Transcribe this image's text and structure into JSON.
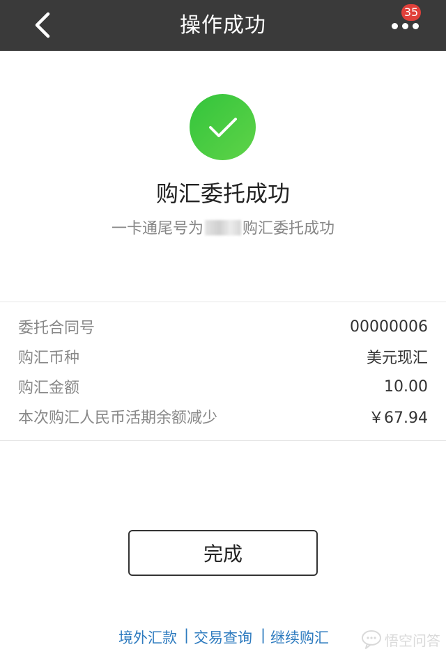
{
  "navbar": {
    "title": "操作成功",
    "badge_count": "35",
    "back_icon": "chevron-left-icon",
    "more_icon": "more-dots-icon",
    "background": "#3a3a3a"
  },
  "result": {
    "icon": "success-check-icon",
    "icon_color": "#3cc83c",
    "title": "购汇委托成功",
    "desc_prefix": "一卡通尾号为",
    "desc_suffix": "购汇委托成功"
  },
  "details": [
    {
      "label": "委托合同号",
      "value": "00000006"
    },
    {
      "label": "购汇币种",
      "value": "美元现汇"
    },
    {
      "label": "购汇金额",
      "value": "10.00"
    },
    {
      "label": "本次购汇人民币活期余额减少",
      "value": "￥67.94"
    }
  ],
  "done_button": {
    "label": "完成"
  },
  "footer_links": [
    {
      "label": "境外汇款"
    },
    {
      "label": "交易查询"
    },
    {
      "label": "继续购汇"
    }
  ],
  "footer_separator": "|",
  "watermark": {
    "text": "悟空问答"
  },
  "colors": {
    "link": "#2e7bbf",
    "badge": "#e0403a"
  }
}
